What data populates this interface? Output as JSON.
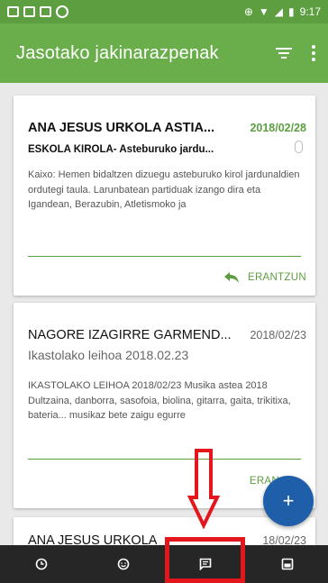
{
  "status_bar": {
    "time": "9:17"
  },
  "app_bar": {
    "title": "Jasotako jakinarazpenak"
  },
  "messages": [
    {
      "sender": "ANA JESUS URKOLA ASTIA...",
      "date": "2018/02/28",
      "subject": "ESKOLA KIROLA- Asteburuko jardu...",
      "preview": "Kaixo: Hemen bidaltzen dizuegu asteburuko kirol jardunaldien ordutegi taula. Larunbatean partiduak izango dira eta Igandean, Berazubin, Atletismoko ja",
      "reply_label": "ERANTZUN",
      "unread": true
    },
    {
      "sender": "NAGORE IZAGIRRE GARMEND...",
      "date": "2018/02/23",
      "subject": "Ikastolako leihoa 2018.02.23",
      "preview": "IKASTOLAKO LEIHOA 2018/02/23 Musika astea 2018 Dultzaina, danborra, sasofoia, biolina, gitarra, gaita, trikitixa, bateria... musikaz bete zaigu egurre",
      "reply_label": "ERAN",
      "unread": false
    },
    {
      "sender": "ANA JESUS URKOLA",
      "date": "18/02/23"
    }
  ],
  "fab": {
    "label": "+"
  },
  "colors": {
    "primary": "#6aae4b",
    "status_bar": "#5d9e41",
    "fab": "#1f5ea8",
    "nav_bg": "#262626",
    "annotation": "#e3161b"
  }
}
